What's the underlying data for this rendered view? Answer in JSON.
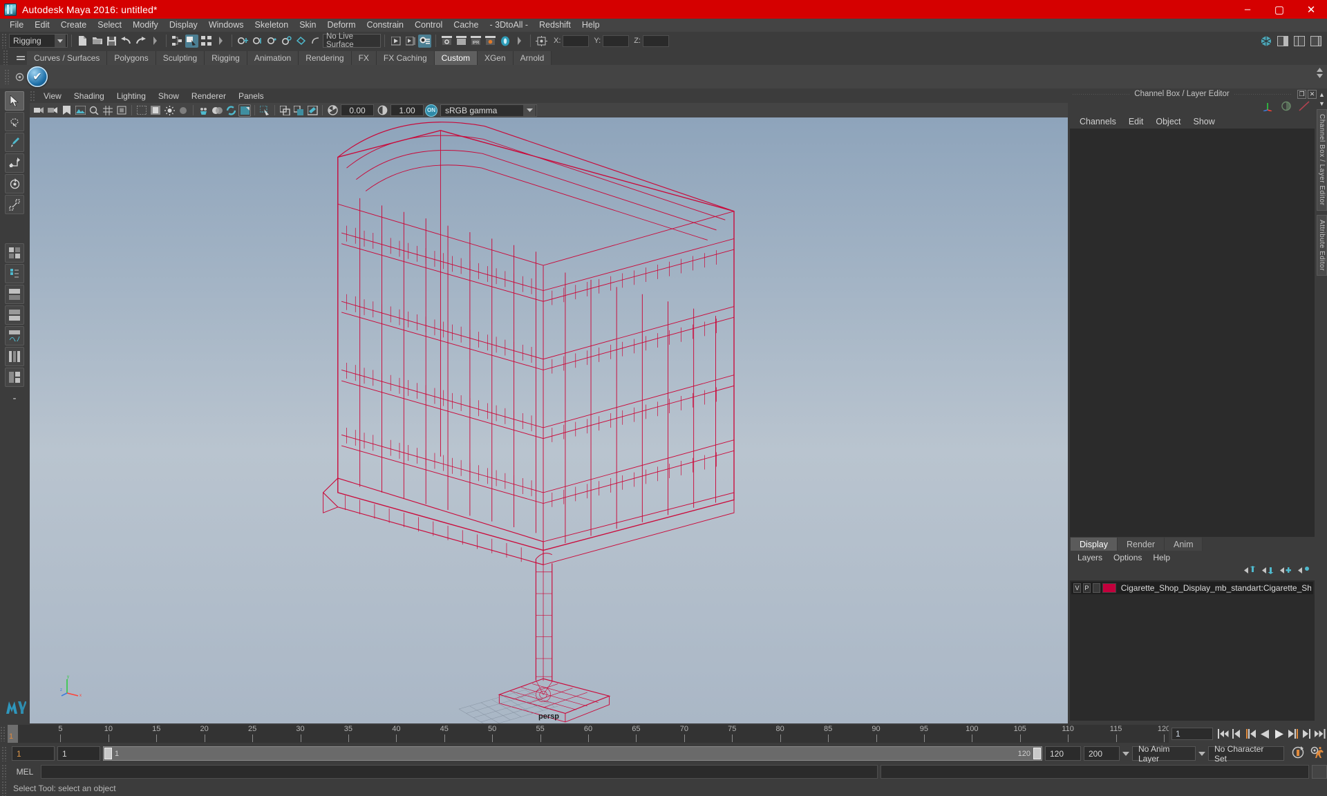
{
  "window": {
    "title": "Autodesk Maya 2016: untitled*",
    "app_icon": "maya-icon",
    "minimize": "–",
    "maximize": "▢",
    "close": "✕",
    "titlebar_color": "#d50000"
  },
  "menubar": {
    "items": [
      "File",
      "Edit",
      "Create",
      "Select",
      "Modify",
      "Display",
      "Windows",
      "Skeleton",
      "Skin",
      "Deform",
      "Constrain",
      "Control",
      "Cache",
      "- 3DtoAll -",
      "Redshift",
      "Help"
    ]
  },
  "statusline": {
    "mode": "Rigging",
    "live_surface": "No Live Surface",
    "x_label": "X:",
    "y_label": "Y:",
    "z_label": "Z:",
    "x_value": "",
    "y_value": "",
    "z_value": ""
  },
  "shelf": {
    "tabs": [
      "Curves / Surfaces",
      "Polygons",
      "Sculpting",
      "Rigging",
      "Animation",
      "Rendering",
      "FX",
      "FX Caching",
      "Custom",
      "XGen",
      "Arnold"
    ],
    "active_tab": "Custom"
  },
  "viewport": {
    "menu": [
      "View",
      "Shading",
      "Lighting",
      "Show",
      "Renderer",
      "Panels"
    ],
    "exposure": "0.00",
    "gamma": "1.00",
    "color_management": "sRGB gamma",
    "camera_label": "persp"
  },
  "right_panel": {
    "title": "Channel Box / Layer Editor",
    "menu": [
      "Channels",
      "Edit",
      "Object",
      "Show"
    ],
    "restore_glyph": "❐",
    "close_glyph": "✕",
    "vertical_tabs": [
      "Channel Box / Layer Editor",
      "Attribute Editor"
    ]
  },
  "layer_editor": {
    "tabs": [
      "Display",
      "Render",
      "Anim"
    ],
    "active_tab": "Display",
    "menu": [
      "Layers",
      "Options",
      "Help"
    ],
    "layers": [
      {
        "visibility": "V",
        "playback": "P",
        "color": "#c2003c",
        "name": "Cigarette_Shop_Display_mb_standart:Cigarette_Shop_Di"
      }
    ]
  },
  "timeslider": {
    "ticks": [
      5,
      10,
      15,
      20,
      25,
      30,
      35,
      40,
      45,
      50,
      55,
      60,
      65,
      70,
      75,
      80,
      85,
      90,
      95,
      100,
      105,
      110,
      115,
      120
    ],
    "current_frame": "1",
    "current_frame_field": "1",
    "playback_buttons": [
      "go-to-start",
      "step-back-key",
      "step-back-frame",
      "play-backwards",
      "play-forwards",
      "step-forward-frame",
      "step-forward-key",
      "go-to-end"
    ]
  },
  "rangeslider": {
    "anim_start": "1",
    "playback_start": "1",
    "range_left_value": "1",
    "range_right_value": "120",
    "playback_end": "120",
    "anim_end": "200",
    "anim_layer": "No Anim Layer",
    "character_set": "No Character Set"
  },
  "commandline": {
    "language": "MEL",
    "input_value": "",
    "output_value": ""
  },
  "helpline": {
    "text": "Select Tool: select an object"
  },
  "colors": {
    "title_red": "#d50000",
    "accent_teal": "#4fb9cd",
    "wireframe_red": "#cc0033",
    "orange": "#e08a3c",
    "panel_bg": "#3c3c3c"
  }
}
